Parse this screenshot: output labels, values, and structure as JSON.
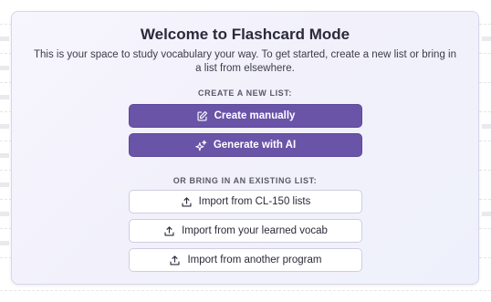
{
  "modal": {
    "title": "Welcome to Flashcard Mode",
    "subtitle": "This is your space to study vocabulary your way. To get started, create a new list or bring in a list from elsewhere."
  },
  "create_section": {
    "heading": "CREATE A NEW LIST:",
    "buttons": [
      {
        "label": "Create manually",
        "icon": "edit-icon"
      },
      {
        "label": "Generate with AI",
        "icon": "sparkle-icon"
      }
    ]
  },
  "import_section": {
    "heading": "OR BRING IN AN EXISTING LIST:",
    "buttons": [
      {
        "label": "Import from CL-150 lists",
        "icon": "upload-icon"
      },
      {
        "label": "Import from your learned vocab",
        "icon": "upload-icon"
      },
      {
        "label": "Import from another program",
        "icon": "upload-icon"
      }
    ]
  },
  "colors": {
    "primary_button": "#6a54a8",
    "card_background": "#f3f2fc"
  }
}
